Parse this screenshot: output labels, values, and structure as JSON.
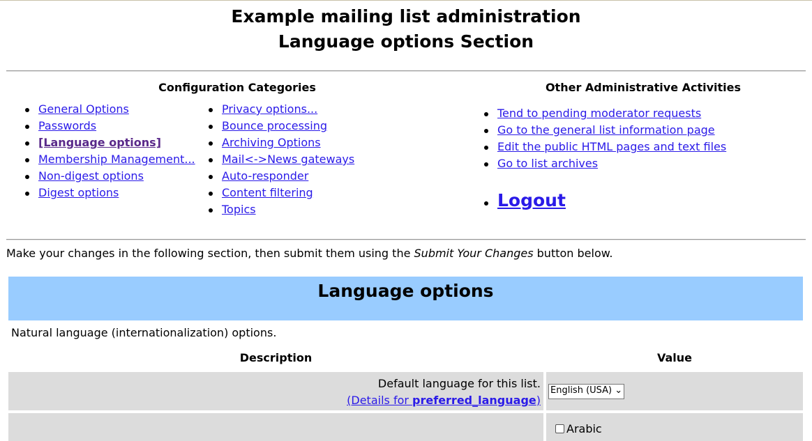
{
  "header": {
    "title": "Example mailing list administration",
    "subtitle": "Language options Section"
  },
  "categories": {
    "heading": "Configuration Categories",
    "col1": [
      "General Options",
      "Passwords",
      "[Language options]",
      "Membership Management...",
      "Non-digest options",
      "Digest options"
    ],
    "col2": [
      "Privacy options...",
      "Bounce processing",
      "Archiving Options",
      "Mail<->News gateways",
      "Auto-responder",
      "Content filtering",
      "Topics"
    ]
  },
  "other": {
    "heading": "Other Administrative Activities",
    "items": [
      "Tend to pending moderator requests",
      "Go to the general list information page",
      "Edit the public HTML pages and text files",
      "Go to list archives"
    ],
    "logout": "Logout"
  },
  "intro": {
    "before": "Make your changes in the following section, then submit them using the ",
    "emph": "Submit Your Changes",
    "after": " button below."
  },
  "section": {
    "title": "Language options",
    "description": "Natural language (internationalization) options.",
    "col_description": "Description",
    "col_value": "Value",
    "rows": [
      {
        "desc": "Default language for this list.",
        "details_prefix": "(Details for ",
        "details_link": "preferred_language",
        "details_suffix": ")",
        "select_value": "English (USA)"
      },
      {
        "checkbox_label": "Arabic"
      }
    ]
  },
  "colors": {
    "section_header_bg": "#99ccff",
    "row_bg": "#dcdcdc",
    "link": "#2a1ae8"
  }
}
